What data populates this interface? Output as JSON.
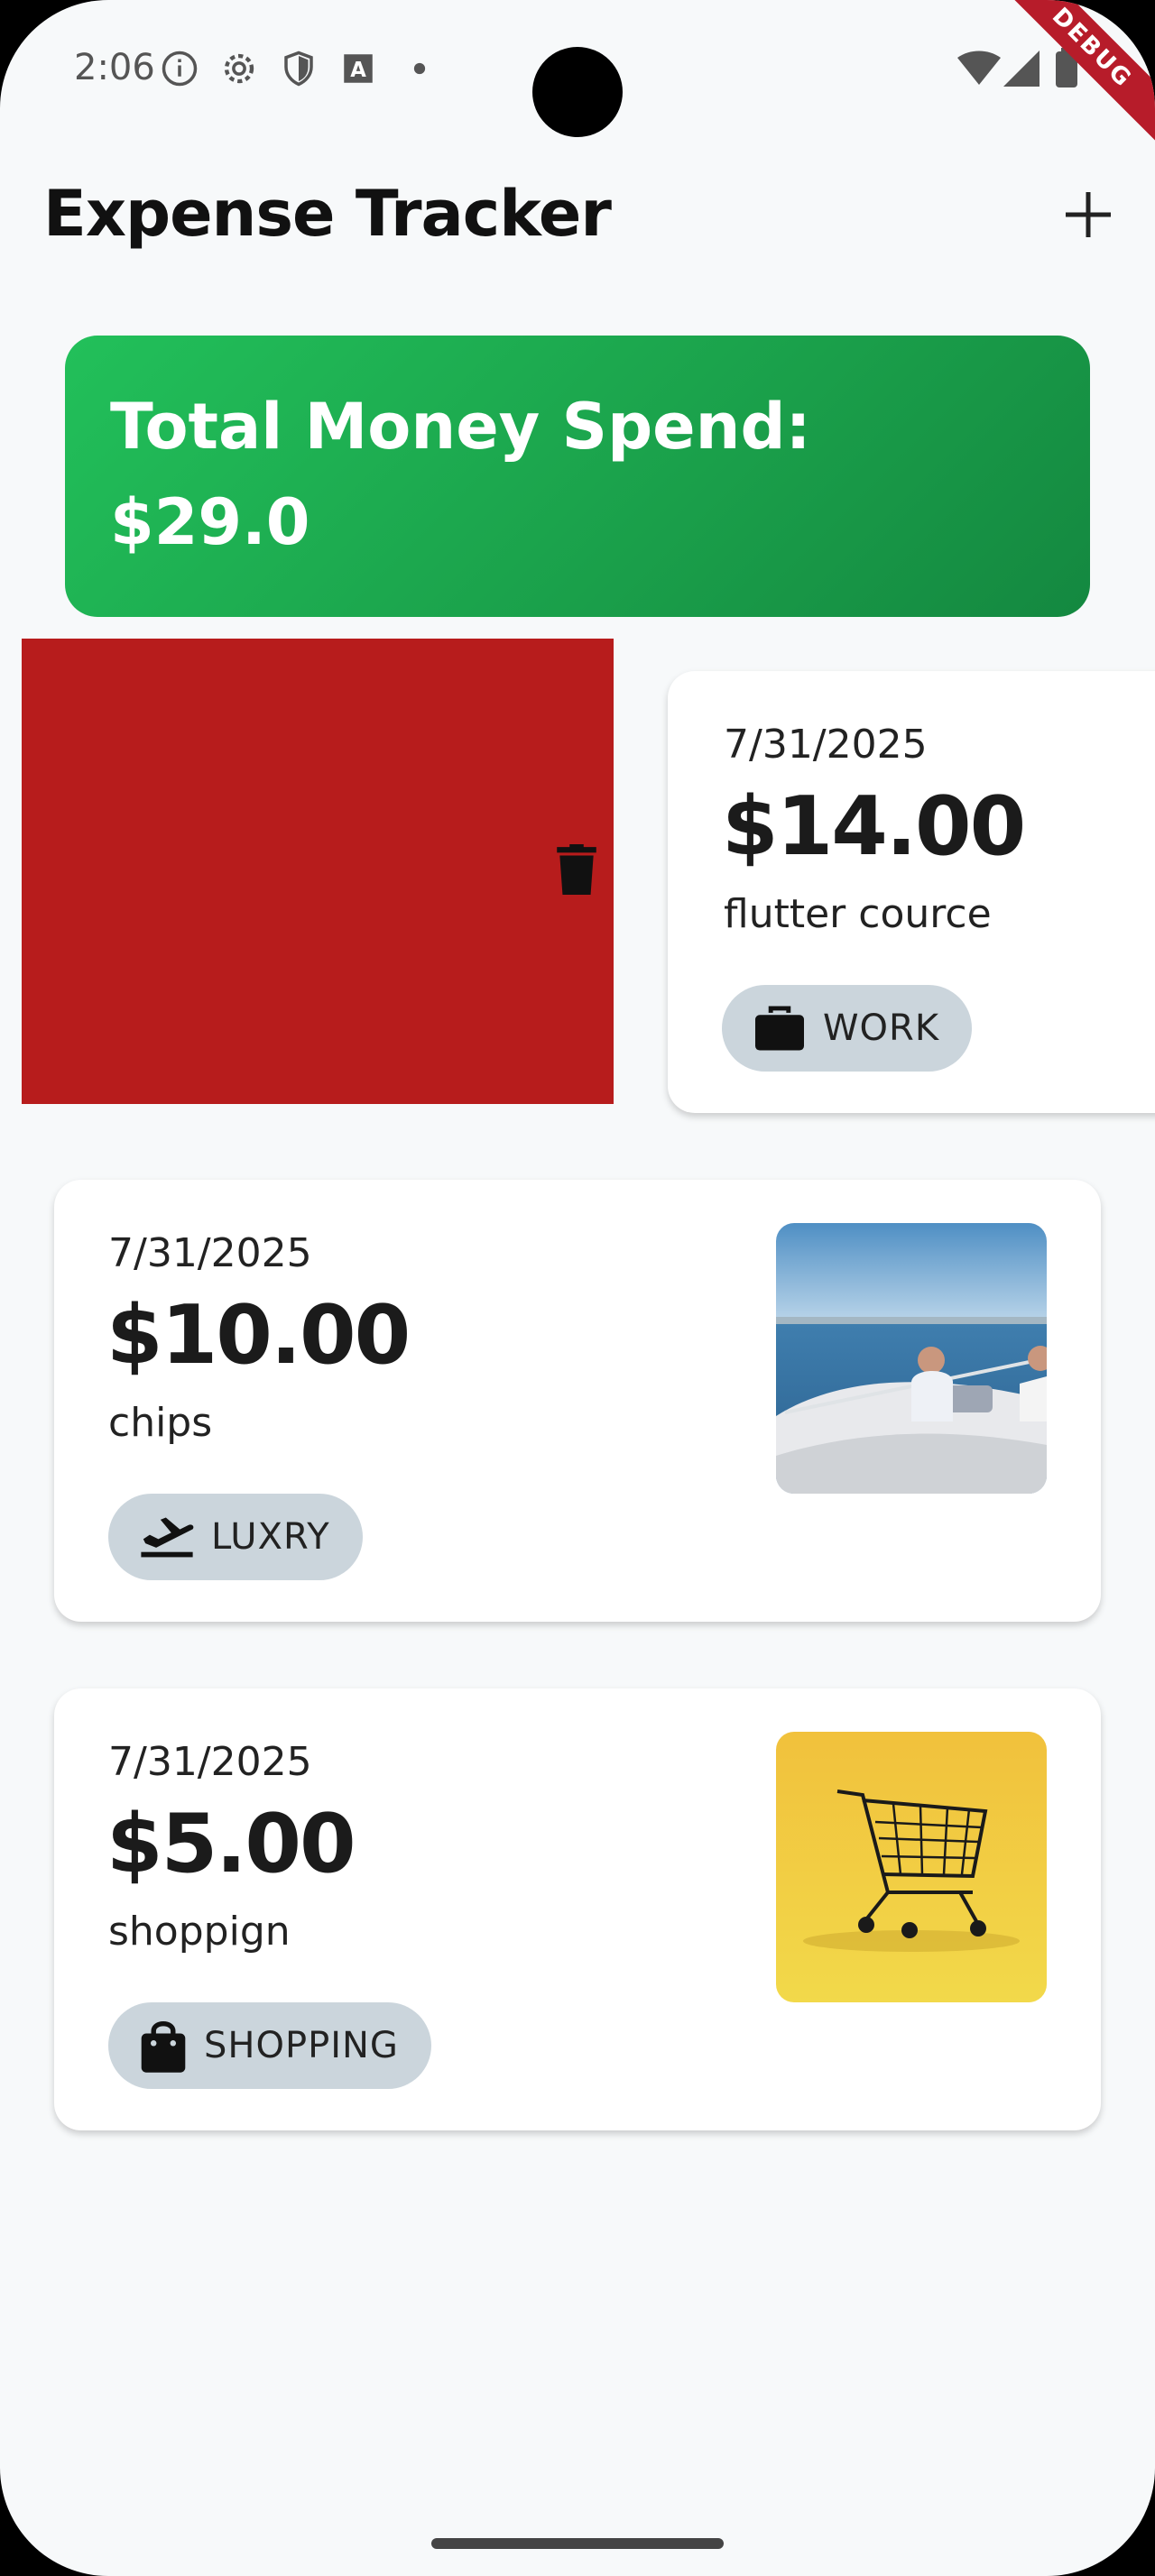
{
  "status_bar": {
    "time": "2:06",
    "icons": [
      "info-icon",
      "settings-icon",
      "shield-icon",
      "font-icon",
      "dot-icon"
    ],
    "right_icons": [
      "wifi-icon",
      "signal-icon",
      "battery-icon"
    ],
    "debug_badge": "DEBUG"
  },
  "app_bar": {
    "title": "Expense Tracker",
    "action_icon": "plus-icon"
  },
  "summary": {
    "label": "Total Money Spend:",
    "value": "$29.0",
    "colors": {
      "start": "#22c05a",
      "end": "#148840"
    }
  },
  "swipe_action": {
    "icon": "trash-icon",
    "color": "#b71c1c"
  },
  "expenses": [
    {
      "date": "7/31/2025",
      "amount": "$14.00",
      "title": "flutter cource",
      "category": "WORK",
      "category_icon": "briefcase-icon",
      "image": null
    },
    {
      "date": "7/31/2025",
      "amount": "$10.00",
      "title": "chips",
      "category": "LUXRY",
      "category_icon": "flight-takeoff-icon",
      "image": "yacht-photo"
    },
    {
      "date": "7/31/2025",
      "amount": "$5.00",
      "title": "shoppign",
      "category": "SHOPPING",
      "category_icon": "shopping-bag-icon",
      "image": "shopping-cart-photo"
    }
  ]
}
